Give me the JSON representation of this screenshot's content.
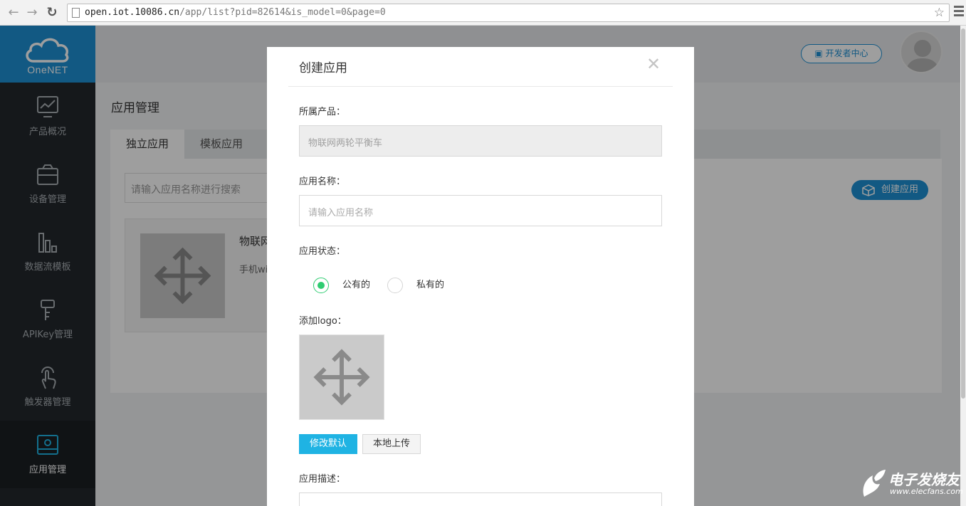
{
  "browser": {
    "url_host": "open.iot.10086.cn",
    "url_path": "/app/list?pid=82614&is_model=0&page=0"
  },
  "logo": {
    "text": "OneNET"
  },
  "sidebar": {
    "items": [
      {
        "label": "产品概况",
        "icon": "chart-monitor-icon"
      },
      {
        "label": "设备管理",
        "icon": "device-icon"
      },
      {
        "label": "数据流模板",
        "icon": "bars-icon"
      },
      {
        "label": "APIKey管理",
        "icon": "key-icon"
      },
      {
        "label": "触发器管理",
        "icon": "touch-icon"
      },
      {
        "label": "应用管理",
        "icon": "app-gear-icon",
        "active": true
      }
    ]
  },
  "topbar": {
    "dev_center": "开发者中心"
  },
  "page": {
    "title": "应用管理",
    "tabs": [
      {
        "label": "独立应用",
        "active": true
      },
      {
        "label": "模板应用"
      }
    ],
    "search_placeholder": "请输入应用名称进行搜索",
    "create_button": "创建应用",
    "card": {
      "name": "物联网",
      "desc": "手机wi"
    }
  },
  "modal": {
    "title": "创建应用",
    "product_label": "所属产品：",
    "product_value": "物联网两轮平衡车",
    "name_label": "应用名称：",
    "name_placeholder": "请输入应用名称",
    "status_label": "应用状态：",
    "status_public": "公有的",
    "status_private": "私有的",
    "logo_label": "添加logo：",
    "btn_default_logo": "修改默认",
    "btn_upload": "本地上传",
    "desc_label": "应用描述："
  },
  "watermark": {
    "cn": "电子发烧友",
    "en": "www.elecfans.com"
  },
  "colors": {
    "brand": "#1e90d3",
    "sidebar": "#23282d",
    "radio_checked": "#2ecc71",
    "button_primary": "#1fb3e3"
  }
}
